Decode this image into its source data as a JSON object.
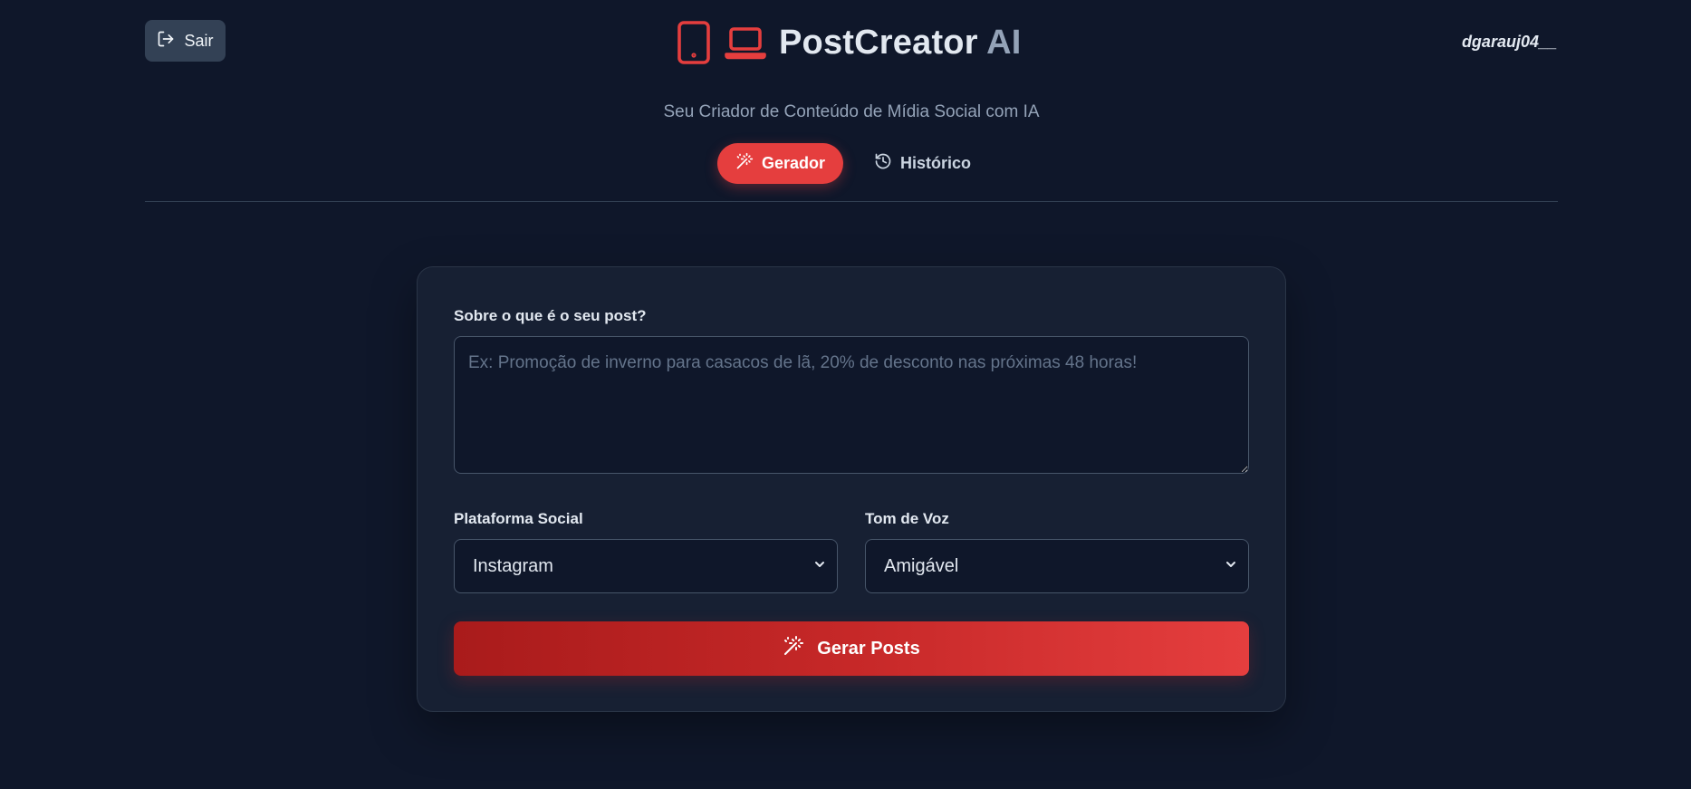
{
  "header": {
    "logout_label": "Sair",
    "brand_main": "PostCreator",
    "brand_ai": "AI",
    "username": "dgarauj04__",
    "subtitle": "Seu Criador de Conteúdo de Mídia Social com IA"
  },
  "tabs": [
    {
      "label": "Gerador",
      "active": true
    },
    {
      "label": "Histórico",
      "active": false
    }
  ],
  "form": {
    "topic_label": "Sobre o que é o seu post?",
    "topic_placeholder": "Ex: Promoção de inverno para casacos de lã, 20% de desconto nas próximas 48 horas!",
    "topic_value": "",
    "platform_label": "Plataforma Social",
    "platform_value": "Instagram",
    "tone_label": "Tom de Voz",
    "tone_value": "Amigável",
    "submit_label": "Gerar Posts"
  },
  "colors": {
    "background": "#0f172a",
    "accent": "#e53e3e",
    "card": "#172033"
  },
  "icons": {
    "logout": "logout-icon",
    "brand_phone": "smartphone-icon",
    "brand_laptop": "laptop-icon",
    "generator": "magic-wand-icon",
    "history": "history-icon",
    "select_arrow": "chevron-down-icon"
  }
}
